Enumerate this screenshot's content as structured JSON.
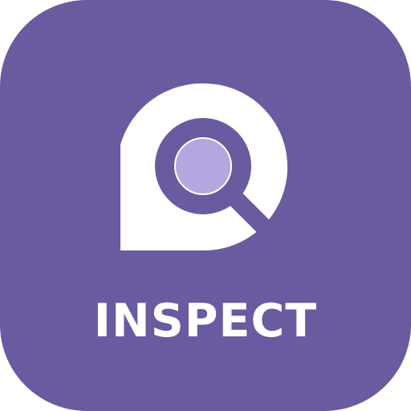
{
  "app": {
    "name": "INSPECT"
  },
  "colors": {
    "tile_background": "#6a5a9f",
    "pin_fill": "#ffffff",
    "magnifier_ring": "#6a5a9f",
    "lens_fill": "#b4a6df",
    "text": "#ffffff"
  },
  "icons": {
    "logo": "map-pin-with-magnifier-icon"
  }
}
